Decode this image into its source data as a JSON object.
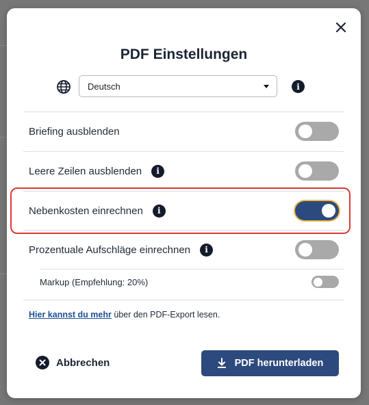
{
  "modal": {
    "title": "PDF Einstellungen",
    "language": {
      "selected": "Deutsch"
    },
    "options": [
      {
        "label": "Briefing ausblenden",
        "enabled": false,
        "has_info": false
      },
      {
        "label": "Leere Zeilen ausblenden",
        "enabled": false,
        "has_info": true
      },
      {
        "label": "Nebenkosten einrechnen",
        "enabled": true,
        "has_info": true,
        "highlighted": true
      },
      {
        "label": "Prozentuale Aufschläge einrechnen",
        "enabled": false,
        "has_info": true
      },
      {
        "label": "Markup (Empfehlung: 20%)",
        "enabled": false,
        "has_info": false,
        "sub_option": true
      }
    ],
    "footer_link": "Hier kannst du mehr",
    "footer_text": " über den PDF-Export lesen.",
    "cancel_label": "Abbrechen",
    "download_label": "PDF herunterladen"
  },
  "colors": {
    "primary": "#2d4a7e",
    "toggle_off": "#a9a9a9",
    "highlight_border": "#d93a35",
    "focus_ring": "#f0b84a",
    "link": "#1e4f96"
  },
  "icons": [
    "close-icon",
    "globe-icon",
    "info-icon",
    "chevron-down-icon",
    "x-circle-icon",
    "download-icon"
  ]
}
